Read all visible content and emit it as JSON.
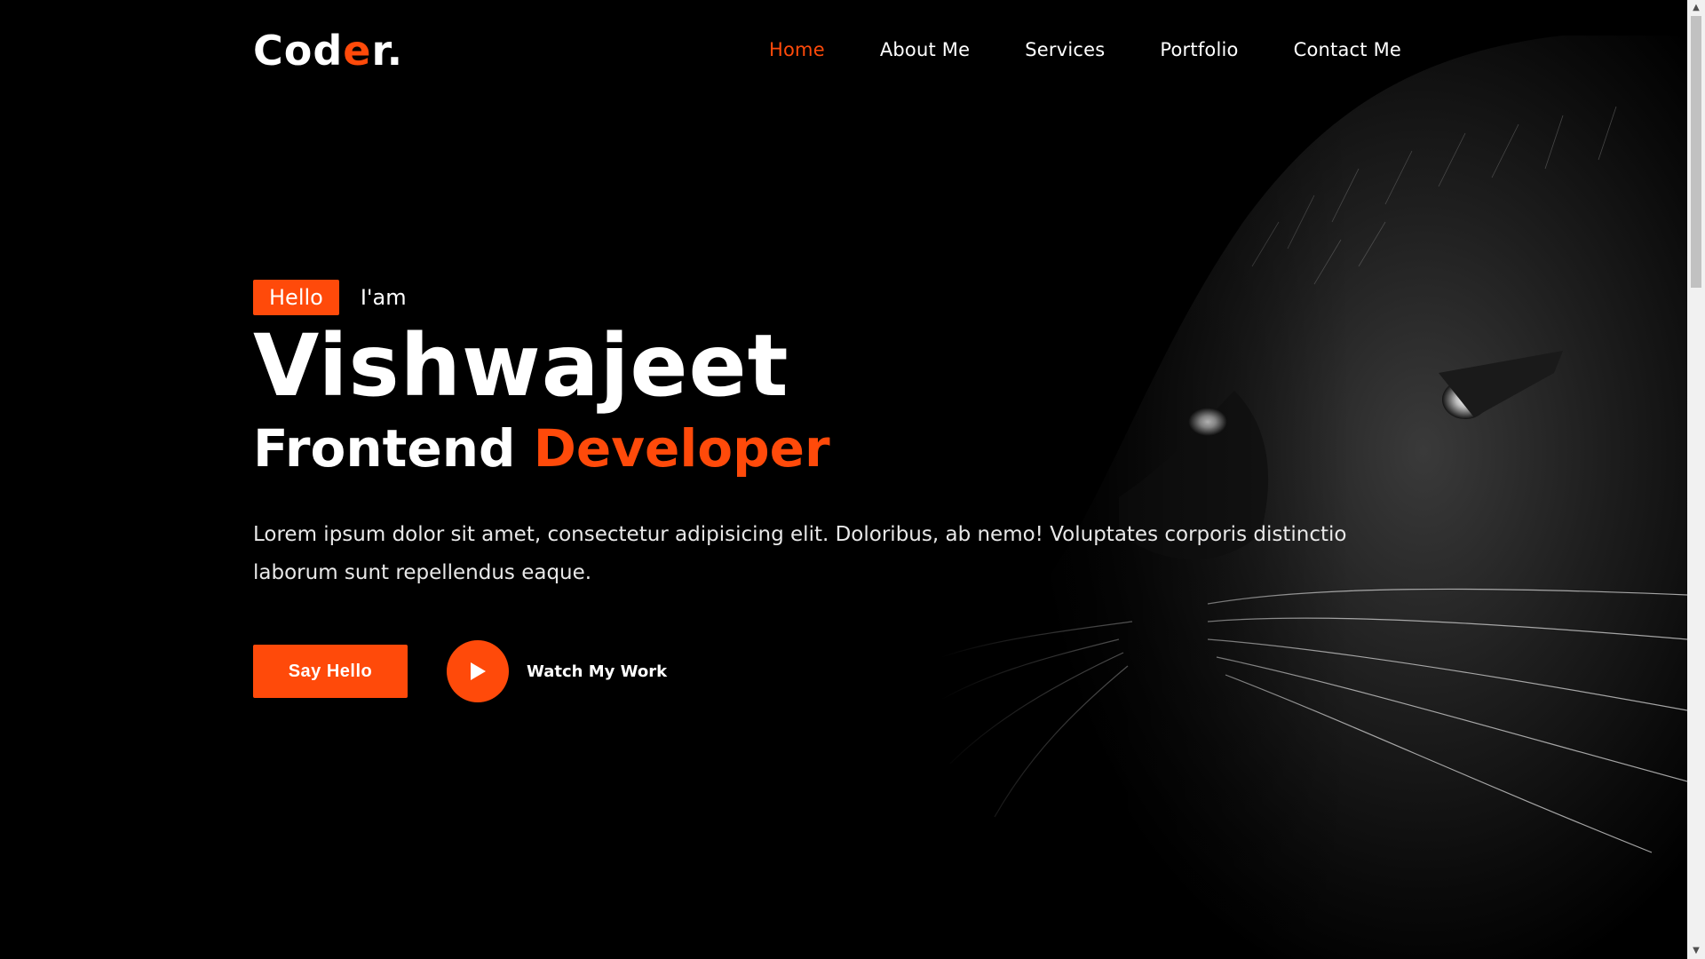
{
  "logo": {
    "part1": "Cod",
    "part2": "e",
    "part3": "r."
  },
  "nav": {
    "items": [
      {
        "label": "Home",
        "active": true
      },
      {
        "label": "About Me",
        "active": false
      },
      {
        "label": "Services",
        "active": false
      },
      {
        "label": "Portfolio",
        "active": false
      },
      {
        "label": "Contact Me",
        "active": false
      }
    ]
  },
  "hero": {
    "badge": "Hello",
    "intro": "I'am",
    "name": "Vishwajeet",
    "role_part1": "Frontend",
    "role_part2": "Developer",
    "description": "Lorem ipsum dolor sit amet, consectetur adipisicing elit. Doloribus, ab nemo! Voluptates corporis distinctio laborum sunt repellendus eaque.",
    "cta_primary": "Say Hello",
    "cta_secondary": "Watch My Work"
  },
  "colors": {
    "accent": "#ff4a0a",
    "background": "#000000",
    "text": "#ffffff"
  },
  "icons": {
    "play": "play-icon",
    "scroll_up": "chevron-up-icon",
    "scroll_down": "chevron-down-icon"
  }
}
